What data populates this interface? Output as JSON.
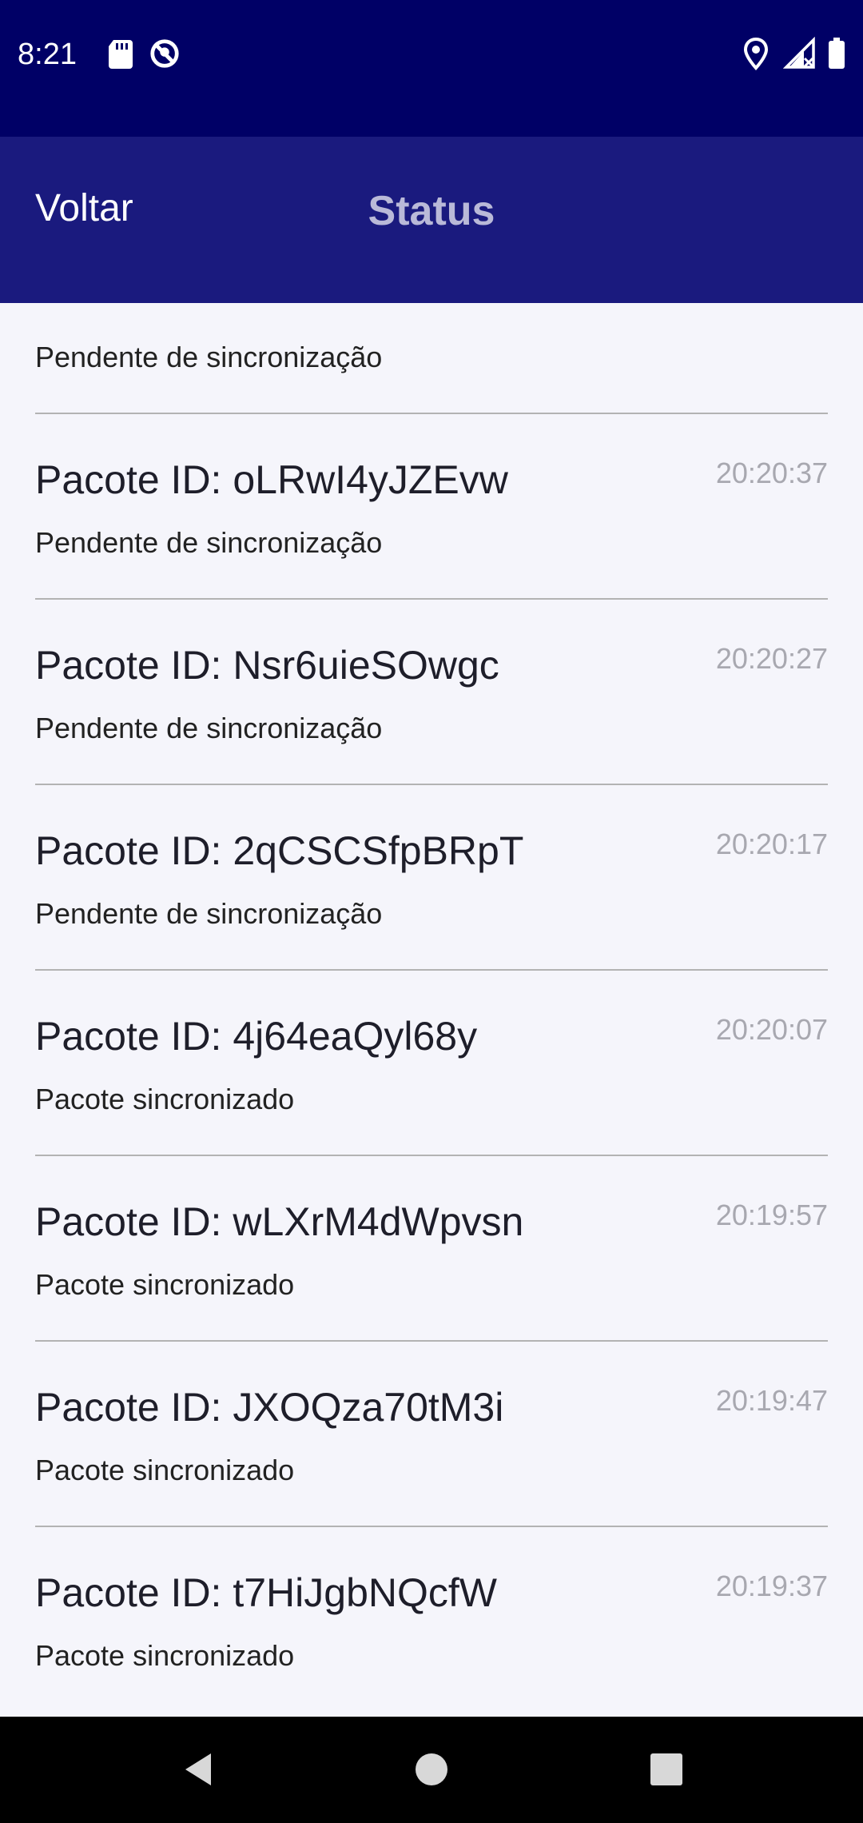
{
  "status_bar": {
    "time": "8:21",
    "left_icons": [
      "sd-card-icon",
      "vpn-no-location-icon"
    ],
    "right_icons": [
      "location-icon",
      "signal-no-data-icon",
      "battery-icon"
    ]
  },
  "app_bar": {
    "back_label": "Voltar",
    "title": "Status",
    "background": "#1a1a7e"
  },
  "list": {
    "header_status": "Pendente de sincronização",
    "items": [
      {
        "title": "Pacote ID: oLRwI4yJZEvw",
        "time": "20:20:37",
        "status": "Pendente de sincronização"
      },
      {
        "title": "Pacote ID: Nsr6uieSOwgc",
        "time": "20:20:27",
        "status": "Pendente de sincronização"
      },
      {
        "title": "Pacote ID: 2qCSCSfpBRpT",
        "time": "20:20:17",
        "status": "Pendente de sincronização"
      },
      {
        "title": "Pacote ID: 4j64eaQyl68y",
        "time": "20:20:07",
        "status": "Pacote sincronizado"
      },
      {
        "title": "Pacote ID: wLXrM4dWpvsn",
        "time": "20:19:57",
        "status": "Pacote sincronizado"
      },
      {
        "title": "Pacote ID: JXOQza70tM3i",
        "time": "20:19:47",
        "status": "Pacote sincronizado"
      },
      {
        "title": "Pacote ID: t7HiJgbNQcfW",
        "time": "20:19:37",
        "status": "Pacote sincronizado"
      }
    ]
  },
  "nav_bar": {
    "buttons": [
      "back-icon",
      "home-icon",
      "recents-icon"
    ]
  }
}
